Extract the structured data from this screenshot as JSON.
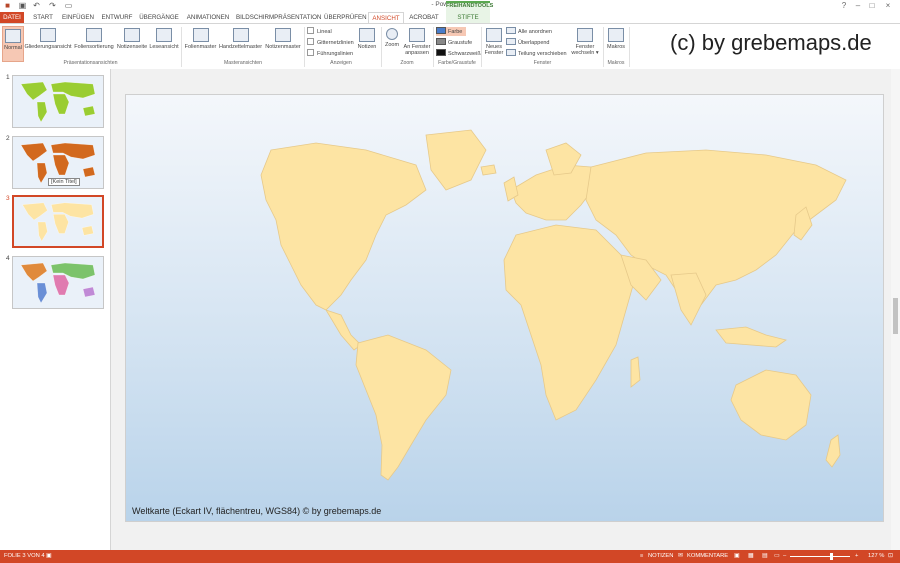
{
  "window": {
    "title": "- PowerPoint"
  },
  "tabs": [
    "DATEI",
    "START",
    "EINFÜGEN",
    "ENTWURF",
    "ÜBERGÄNGE",
    "ANIMATIONEN",
    "BILDSCHIRMPRÄSENTATION",
    "ÜBERPRÜFEN",
    "ANSICHT",
    "ACROBAT",
    "STIFTE"
  ],
  "context_group": "FREIHANDTOOLS",
  "ribbon": {
    "buttons": [
      "Normal",
      "Gliederungsansicht",
      "Foliensortierung",
      "Notizenseite",
      "Leseansicht",
      "Folienmaster",
      "Handzettelmaster",
      "Notizenmaster",
      "Notizen",
      "Zoom",
      "An Fenster anpassen",
      "Neues Fenster",
      "Fenster wechseln ▾",
      "Makros"
    ],
    "groups": [
      "Präsentationsansichten",
      "Masteransichten",
      "Anzeigen",
      "Zoom",
      "Farbe/Graustufe",
      "Fenster",
      "Makros"
    ],
    "checkboxes": [
      "Lineal",
      "Gitternetzlinien",
      "Führungslinien"
    ],
    "color_options": [
      "Farbe",
      "Graustufe",
      "Schwarzweiß"
    ],
    "window_options": [
      "Alle anordnen",
      "Überlappend",
      "Teilung verschieben"
    ]
  },
  "watermark": "(c) by grebemaps.de",
  "thumbnails": [
    {
      "num": "1",
      "color": "#9acd32"
    },
    {
      "num": "2",
      "color": "#d2691e"
    },
    {
      "num": "3",
      "color": "#fde4a3"
    },
    {
      "num": "4",
      "color": "#e08a3c"
    }
  ],
  "tooltip": "[Kein Titel]",
  "slide": {
    "caption": "Weltkarte (Eckart IV, flächentreu, WGS84) © by grebemaps.de",
    "land_color": "#fde4a3"
  },
  "status": {
    "slide_info": "FOLIE 3 VON 4",
    "notes": "NOTIZEN",
    "comments": "KOMMENTARE",
    "zoom": "127 %"
  },
  "colors": {
    "accent": "#d24726"
  }
}
